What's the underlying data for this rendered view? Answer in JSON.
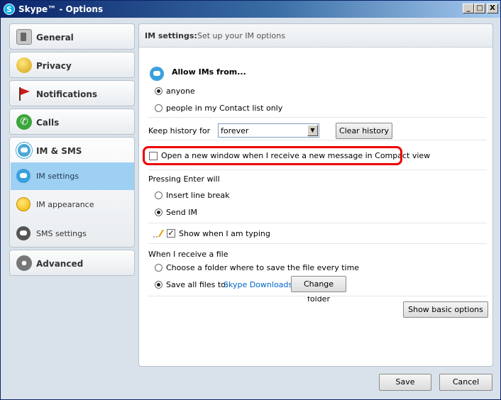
{
  "window": {
    "title": "Skype™ - Options"
  },
  "titlebar": {
    "minimize": "_",
    "maximize": "□",
    "close": "X"
  },
  "sidebar": {
    "general": "General",
    "privacy": "Privacy",
    "notifications": "Notifications",
    "calls": "Calls",
    "im_sms": "IM & SMS",
    "sub_items": [
      "IM settings",
      "IM appearance",
      "SMS settings"
    ],
    "advanced": "Advanced"
  },
  "header": {
    "bold": "IM settings:",
    "subtitle": "Set up your IM options"
  },
  "allow": {
    "title": "Allow IMs from...",
    "options": [
      "anyone",
      "people in my Contact list only"
    ],
    "selected": "anyone"
  },
  "history": {
    "label": "Keep history for",
    "value": "forever",
    "clear_button": "Clear history"
  },
  "compact": {
    "label": "Open a new window when I receive a new message in Compact view",
    "checked": false
  },
  "enter": {
    "title": "Pressing Enter will",
    "options": [
      "Insert line break",
      "Send IM"
    ],
    "selected": "Send IM"
  },
  "typing": {
    "label": "Show when I am typing",
    "checked": true,
    "check_glyph": "✓"
  },
  "file": {
    "title": "When I receive a file",
    "choose_option": "Choose a folder where to save the file every time",
    "save_option": "Save all files to:",
    "folder_link": "Skype Downloads",
    "change_button": "Change folder",
    "selected": "Save all files to:"
  },
  "show_basic": "Show basic options",
  "footer": {
    "save": "Save",
    "cancel": "Cancel"
  },
  "colors": {
    "highlight": "#e00000",
    "selected_nav": "#9ed0f3",
    "link": "#0066cc"
  }
}
